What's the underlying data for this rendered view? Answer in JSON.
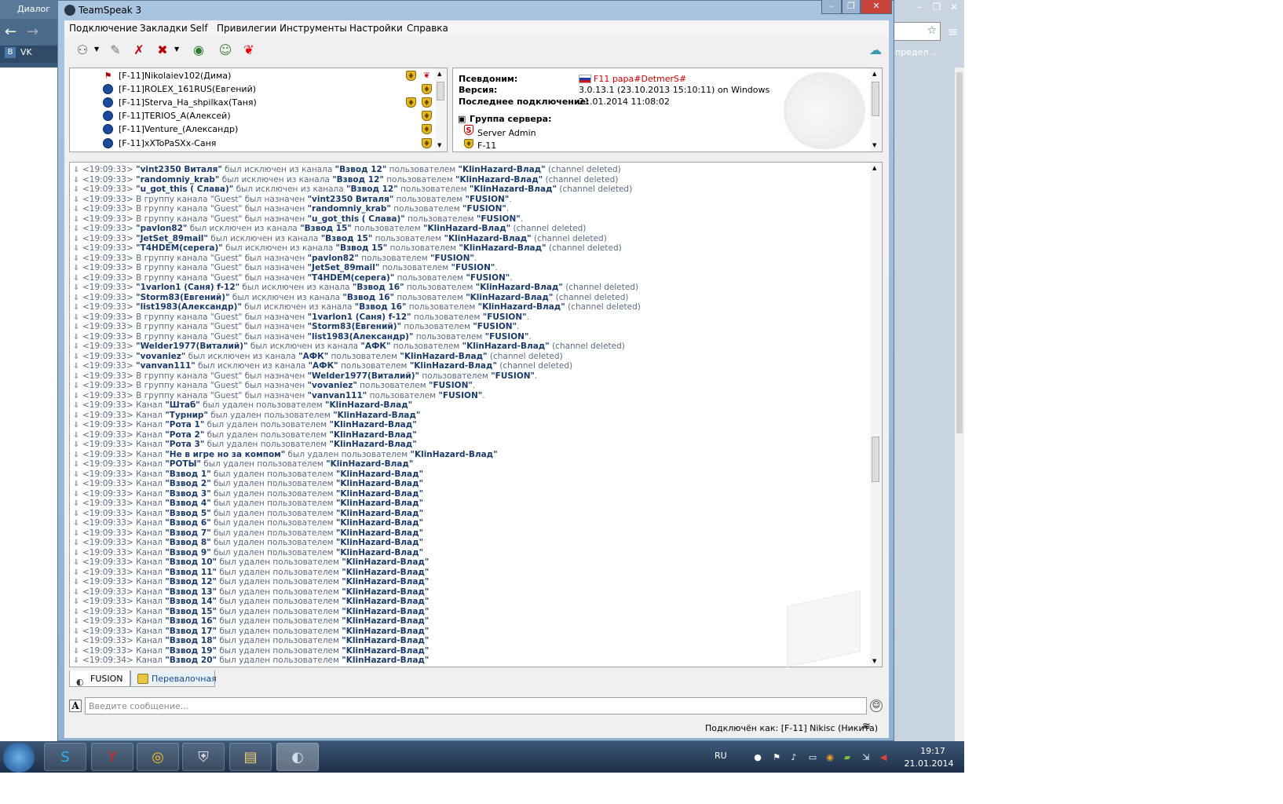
{
  "chrome": {
    "tab_title": "Диалог",
    "bookmark_vk": "VK",
    "bookmark_right": "предел ...",
    "win_buttons": [
      "–",
      "❐",
      "✕"
    ]
  },
  "window": {
    "title": "TeamSpeak 3",
    "buttons": [
      "–",
      "❐",
      "✕"
    ]
  },
  "menu": [
    "Подключение",
    "Закладки",
    "Self",
    "Привилегии",
    "Инструменты",
    "Настройки",
    "Справка"
  ],
  "tree": [
    {
      "name": "[F-11]Nikolaiev102(Дима)",
      "icon": "flag-icon",
      "badges": [
        "shield",
        "leaf"
      ]
    },
    {
      "name": "[F-11]ROLEX_161RUS(Евгений)",
      "icon": "user-status-icon",
      "badges": [
        "shield"
      ]
    },
    {
      "name": "[F-11]Sterva_Ha_shpilkax(Таня)",
      "icon": "user-status-icon",
      "badges": [
        "shield",
        "shield"
      ]
    },
    {
      "name": "[F-11]TERIOS_A(Алексей)",
      "icon": "user-status-icon",
      "badges": [
        "shield"
      ]
    },
    {
      "name": "[F-11]Venture_(Александр)",
      "icon": "user-status-icon",
      "badges": [
        "shield"
      ]
    },
    {
      "name": "[F-11]xXToPaSXx-Саня",
      "icon": "user-status-icon",
      "badges": [
        "shield"
      ]
    }
  ],
  "info": {
    "nick_label": "Псевдоним:",
    "nick_value": "F11 papa#DetmerS#",
    "version_label": "Версия:",
    "version_value": "3.0.13.1 (23.10.2013 15:10:11) on Windows",
    "last_label": "Последнее подключение:",
    "last_value": "21.01.2014 11:08:02",
    "group_label": "Группа сервера:",
    "groups": [
      "Server Admin",
      "F-11"
    ],
    "nick_color": "#cc0000"
  },
  "log": [
    [
      [
        "<19:09:33> ",
        0
      ],
      [
        "\"vint2350 Виталя\"",
        1
      ],
      [
        " был исключен из канала ",
        0
      ],
      [
        "\"Взвод 12\"",
        1
      ],
      [
        " пользователем ",
        0
      ],
      [
        "\"KlinHazard-Влад\"",
        1
      ],
      [
        " (channel deleted)",
        0
      ]
    ],
    [
      [
        "<19:09:33> ",
        0
      ],
      [
        "\"randomniy_krab\"",
        1
      ],
      [
        " был исключен из канала ",
        0
      ],
      [
        "\"Взвод 12\"",
        1
      ],
      [
        " пользователем ",
        0
      ],
      [
        "\"KlinHazard-Влад\"",
        1
      ],
      [
        " (channel deleted)",
        0
      ]
    ],
    [
      [
        "<19:09:33> ",
        0
      ],
      [
        "\"u_got_this ( Слава)\"",
        1
      ],
      [
        " был исключен из канала ",
        0
      ],
      [
        "\"Взвод 12\"",
        1
      ],
      [
        " пользователем ",
        0
      ],
      [
        "\"KlinHazard-Влад\"",
        1
      ],
      [
        " (channel deleted)",
        0
      ]
    ],
    [
      [
        "<19:09:33> В группу канала \"Guest\" был назначен ",
        0
      ],
      [
        "\"vint2350 Виталя\"",
        1
      ],
      [
        " пользователем ",
        0
      ],
      [
        "\"FUSION\"",
        1
      ],
      [
        ".",
        0
      ]
    ],
    [
      [
        "<19:09:33> В группу канала \"Guest\" был назначен ",
        0
      ],
      [
        "\"randomniy_krab\"",
        1
      ],
      [
        " пользователем ",
        0
      ],
      [
        "\"FUSION\"",
        1
      ],
      [
        ".",
        0
      ]
    ],
    [
      [
        "<19:09:33> В группу канала \"Guest\" был назначен ",
        0
      ],
      [
        "\"u_got_this ( Слава)\"",
        1
      ],
      [
        " пользователем ",
        0
      ],
      [
        "\"FUSION\"",
        1
      ],
      [
        ".",
        0
      ]
    ],
    [
      [
        "<19:09:33> ",
        0
      ],
      [
        "\"pavlon82\"",
        1
      ],
      [
        " был исключен из канала ",
        0
      ],
      [
        "\"Взвод 15\"",
        1
      ],
      [
        " пользователем ",
        0
      ],
      [
        "\"KlinHazard-Влад\"",
        1
      ],
      [
        " (channel deleted)",
        0
      ]
    ],
    [
      [
        "<19:09:33> ",
        0
      ],
      [
        "\"JetSet_89mail\"",
        1
      ],
      [
        " был исключен из канала ",
        0
      ],
      [
        "\"Взвод 15\"",
        1
      ],
      [
        " пользователем ",
        0
      ],
      [
        "\"KlinHazard-Влад\"",
        1
      ],
      [
        " (channel deleted)",
        0
      ]
    ],
    [
      [
        "<19:09:33> ",
        0
      ],
      [
        "\"T4HDEM(серега)\"",
        1
      ],
      [
        " был исключен из канала ",
        0
      ],
      [
        "\"Взвод 15\"",
        1
      ],
      [
        " пользователем ",
        0
      ],
      [
        "\"KlinHazard-Влад\"",
        1
      ],
      [
        " (channel deleted)",
        0
      ]
    ],
    [
      [
        "<19:09:33> В группу канала \"Guest\" был назначен ",
        0
      ],
      [
        "\"pavlon82\"",
        1
      ],
      [
        " пользователем ",
        0
      ],
      [
        "\"FUSION\"",
        1
      ],
      [
        ".",
        0
      ]
    ],
    [
      [
        "<19:09:33> В группу канала \"Guest\" был назначен ",
        0
      ],
      [
        "\"JetSet_89mail\"",
        1
      ],
      [
        " пользователем ",
        0
      ],
      [
        "\"FUSION\"",
        1
      ],
      [
        ".",
        0
      ]
    ],
    [
      [
        "<19:09:33> В группу канала \"Guest\" был назначен ",
        0
      ],
      [
        "\"T4HDEM(серега)\"",
        1
      ],
      [
        " пользователем ",
        0
      ],
      [
        "\"FUSION\"",
        1
      ],
      [
        ".",
        0
      ]
    ],
    [
      [
        "<19:09:33> ",
        0
      ],
      [
        "\"1varlon1 (Саня) f-12\"",
        1
      ],
      [
        " был исключен из канала ",
        0
      ],
      [
        "\"Взвод 16\"",
        1
      ],
      [
        " пользователем ",
        0
      ],
      [
        "\"KlinHazard-Влад\"",
        1
      ],
      [
        " (channel deleted)",
        0
      ]
    ],
    [
      [
        "<19:09:33> ",
        0
      ],
      [
        "\"Storm83(Евгений)\"",
        1
      ],
      [
        " был исключен из канала ",
        0
      ],
      [
        "\"Взвод 16\"",
        1
      ],
      [
        " пользователем ",
        0
      ],
      [
        "\"KlinHazard-Влад\"",
        1
      ],
      [
        " (channel deleted)",
        0
      ]
    ],
    [
      [
        "<19:09:33> ",
        0
      ],
      [
        "\"list1983(Александр)\"",
        1
      ],
      [
        " был исключен из канала ",
        0
      ],
      [
        "\"Взвод 16\"",
        1
      ],
      [
        " пользователем ",
        0
      ],
      [
        "\"KlinHazard-Влад\"",
        1
      ],
      [
        " (channel deleted)",
        0
      ]
    ],
    [
      [
        "<19:09:33> В группу канала \"Guest\" был назначен ",
        0
      ],
      [
        "\"1varlon1 (Саня) f-12\"",
        1
      ],
      [
        " пользователем ",
        0
      ],
      [
        "\"FUSION\"",
        1
      ],
      [
        ".",
        0
      ]
    ],
    [
      [
        "<19:09:33> В группу канала \"Guest\" был назначен ",
        0
      ],
      [
        "\"Storm83(Евгений)\"",
        1
      ],
      [
        " пользователем ",
        0
      ],
      [
        "\"FUSION\"",
        1
      ],
      [
        ".",
        0
      ]
    ],
    [
      [
        "<19:09:33> В группу канала \"Guest\" был назначен ",
        0
      ],
      [
        "\"list1983(Александр)\"",
        1
      ],
      [
        " пользователем ",
        0
      ],
      [
        "\"FUSION\"",
        1
      ],
      [
        ".",
        0
      ]
    ],
    [
      [
        "<19:09:33> ",
        0
      ],
      [
        "\"Welder1977(Виталий)\"",
        1
      ],
      [
        " был исключен из канала ",
        0
      ],
      [
        "\"АФК\"",
        1
      ],
      [
        " пользователем ",
        0
      ],
      [
        "\"KlinHazard-Влад\"",
        1
      ],
      [
        " (channel deleted)",
        0
      ]
    ],
    [
      [
        "<19:09:33> ",
        0
      ],
      [
        "\"vovaniez\"",
        1
      ],
      [
        " был исключен из канала ",
        0
      ],
      [
        "\"АФК\"",
        1
      ],
      [
        " пользователем ",
        0
      ],
      [
        "\"KlinHazard-Влад\"",
        1
      ],
      [
        " (channel deleted)",
        0
      ]
    ],
    [
      [
        "<19:09:33> ",
        0
      ],
      [
        "\"vanvan111\"",
        1
      ],
      [
        " был исключен из канала ",
        0
      ],
      [
        "\"АФК\"",
        1
      ],
      [
        " пользователем ",
        0
      ],
      [
        "\"KlinHazard-Влад\"",
        1
      ],
      [
        " (channel deleted)",
        0
      ]
    ],
    [
      [
        "<19:09:33> В группу канала \"Guest\" был назначен ",
        0
      ],
      [
        "\"Welder1977(Виталий)\"",
        1
      ],
      [
        " пользователем ",
        0
      ],
      [
        "\"FUSION\"",
        1
      ],
      [
        ".",
        0
      ]
    ],
    [
      [
        "<19:09:33> В группу канала \"Guest\" был назначен ",
        0
      ],
      [
        "\"vovaniez\"",
        1
      ],
      [
        " пользователем ",
        0
      ],
      [
        "\"FUSION\"",
        1
      ],
      [
        ".",
        0
      ]
    ],
    [
      [
        "<19:09:33> В группу канала \"Guest\" был назначен ",
        0
      ],
      [
        "\"vanvan111\"",
        1
      ],
      [
        " пользователем ",
        0
      ],
      [
        "\"FUSION\"",
        1
      ],
      [
        ".",
        0
      ]
    ],
    [
      [
        "<19:09:33> Канал ",
        0
      ],
      [
        "\"Штаб\"",
        1
      ],
      [
        " был удален пользователем ",
        0
      ],
      [
        "\"KlinHazard-Влад\"",
        1
      ]
    ],
    [
      [
        "<19:09:33> Канал ",
        0
      ],
      [
        "\"Турнир\"",
        1
      ],
      [
        " был удален пользователем ",
        0
      ],
      [
        "\"KlinHazard-Влад\"",
        1
      ]
    ],
    [
      [
        "<19:09:33> Канал ",
        0
      ],
      [
        "\"Рота 1\"",
        1
      ],
      [
        " был удален пользователем ",
        0
      ],
      [
        "\"KlinHazard-Влад\"",
        1
      ]
    ],
    [
      [
        "<19:09:33> Канал ",
        0
      ],
      [
        "\"Рота 2\"",
        1
      ],
      [
        " был удален пользователем ",
        0
      ],
      [
        "\"KlinHazard-Влад\"",
        1
      ]
    ],
    [
      [
        "<19:09:33> Канал ",
        0
      ],
      [
        "\"Рота 3\"",
        1
      ],
      [
        " был удален пользователем ",
        0
      ],
      [
        "\"KlinHazard-Влад\"",
        1
      ]
    ],
    [
      [
        "<19:09:33> Канал ",
        0
      ],
      [
        "\"Не в игре но за компом\"",
        1
      ],
      [
        " был удален пользователем ",
        0
      ],
      [
        "\"KlinHazard-Влад\"",
        1
      ]
    ],
    [
      [
        "<19:09:33> Канал ",
        0
      ],
      [
        "\"РОТЫ\"",
        1
      ],
      [
        " был удален пользователем ",
        0
      ],
      [
        "\"KlinHazard-Влад\"",
        1
      ]
    ],
    [
      [
        "<19:09:33> Канал ",
        0
      ],
      [
        "\"Взвод 1\"",
        1
      ],
      [
        " был удален пользователем ",
        0
      ],
      [
        "\"KlinHazard-Влад\"",
        1
      ]
    ],
    [
      [
        "<19:09:33> Канал ",
        0
      ],
      [
        "\"Взвод 2\"",
        1
      ],
      [
        " был удален пользователем ",
        0
      ],
      [
        "\"KlinHazard-Влад\"",
        1
      ]
    ],
    [
      [
        "<19:09:33> Канал ",
        0
      ],
      [
        "\"Взвод 3\"",
        1
      ],
      [
        " был удален пользователем ",
        0
      ],
      [
        "\"KlinHazard-Влад\"",
        1
      ]
    ],
    [
      [
        "<19:09:33> Канал ",
        0
      ],
      [
        "\"Взвод 4\"",
        1
      ],
      [
        " был удален пользователем ",
        0
      ],
      [
        "\"KlinHazard-Влад\"",
        1
      ]
    ],
    [
      [
        "<19:09:33> Канал ",
        0
      ],
      [
        "\"Взвод 5\"",
        1
      ],
      [
        " был удален пользователем ",
        0
      ],
      [
        "\"KlinHazard-Влад\"",
        1
      ]
    ],
    [
      [
        "<19:09:33> Канал ",
        0
      ],
      [
        "\"Взвод 6\"",
        1
      ],
      [
        " был удален пользователем ",
        0
      ],
      [
        "\"KlinHazard-Влад\"",
        1
      ]
    ],
    [
      [
        "<19:09:33> Канал ",
        0
      ],
      [
        "\"Взвод 7\"",
        1
      ],
      [
        " был удален пользователем ",
        0
      ],
      [
        "\"KlinHazard-Влад\"",
        1
      ]
    ],
    [
      [
        "<19:09:33> Канал ",
        0
      ],
      [
        "\"Взвод 8\"",
        1
      ],
      [
        " был удален пользователем ",
        0
      ],
      [
        "\"KlinHazard-Влад\"",
        1
      ]
    ],
    [
      [
        "<19:09:33> Канал ",
        0
      ],
      [
        "\"Взвод 9\"",
        1
      ],
      [
        " был удален пользователем ",
        0
      ],
      [
        "\"KlinHazard-Влад\"",
        1
      ]
    ],
    [
      [
        "<19:09:33> Канал ",
        0
      ],
      [
        "\"Взвод 10\"",
        1
      ],
      [
        " был удален пользователем ",
        0
      ],
      [
        "\"KlinHazard-Влад\"",
        1
      ]
    ],
    [
      [
        "<19:09:33> Канал ",
        0
      ],
      [
        "\"Взвод 11\"",
        1
      ],
      [
        " был удален пользователем ",
        0
      ],
      [
        "\"KlinHazard-Влад\"",
        1
      ]
    ],
    [
      [
        "<19:09:33> Канал ",
        0
      ],
      [
        "\"Взвод 12\"",
        1
      ],
      [
        " был удален пользователем ",
        0
      ],
      [
        "\"KlinHazard-Влад\"",
        1
      ]
    ],
    [
      [
        "<19:09:33> Канал ",
        0
      ],
      [
        "\"Взвод 13\"",
        1
      ],
      [
        " был удален пользователем ",
        0
      ],
      [
        "\"KlinHazard-Влад\"",
        1
      ]
    ],
    [
      [
        "<19:09:33> Канал ",
        0
      ],
      [
        "\"Взвод 14\"",
        1
      ],
      [
        " был удален пользователем ",
        0
      ],
      [
        "\"KlinHazard-Влад\"",
        1
      ]
    ],
    [
      [
        "<19:09:33> Канал ",
        0
      ],
      [
        "\"Взвод 15\"",
        1
      ],
      [
        " был удален пользователем ",
        0
      ],
      [
        "\"KlinHazard-Влад\"",
        1
      ]
    ],
    [
      [
        "<19:09:33> Канал ",
        0
      ],
      [
        "\"Взвод 16\"",
        1
      ],
      [
        " был удален пользователем ",
        0
      ],
      [
        "\"KlinHazard-Влад\"",
        1
      ]
    ],
    [
      [
        "<19:09:33> Канал ",
        0
      ],
      [
        "\"Взвод 17\"",
        1
      ],
      [
        " был удален пользователем ",
        0
      ],
      [
        "\"KlinHazard-Влад\"",
        1
      ]
    ],
    [
      [
        "<19:09:33> Канал ",
        0
      ],
      [
        "\"Взвод 18\"",
        1
      ],
      [
        " был удален пользователем ",
        0
      ],
      [
        "\"KlinHazard-Влад\"",
        1
      ]
    ],
    [
      [
        "<19:09:33> Канал ",
        0
      ],
      [
        "\"Взвод 19\"",
        1
      ],
      [
        " был удален пользователем ",
        0
      ],
      [
        "\"KlinHazard-Влад\"",
        1
      ]
    ],
    [
      [
        "<19:09:34> Канал ",
        0
      ],
      [
        "\"Взвод 20\"",
        1
      ],
      [
        " был удален пользователем ",
        0
      ],
      [
        "\"KlinHazard-Влад\"",
        1
      ]
    ]
  ],
  "tabs": [
    {
      "label": "FUSION",
      "icon": "teamspeak-server-icon"
    },
    {
      "label": "Перевалочная",
      "icon": "chat-bubble-icon"
    }
  ],
  "input": {
    "placeholder": "Введите сообщение..."
  },
  "status": {
    "text": "Подключён как: [F-11] Nikisc (Никита)"
  },
  "taskbar": {
    "apps": [
      "skype-icon",
      "yandex-browser-icon",
      "chrome-icon",
      "world-of-tanks-icon",
      "file-manager-icon",
      "teamspeak-icon"
    ],
    "lang": "RU",
    "time": "19:17",
    "date": "21.01.2014"
  }
}
